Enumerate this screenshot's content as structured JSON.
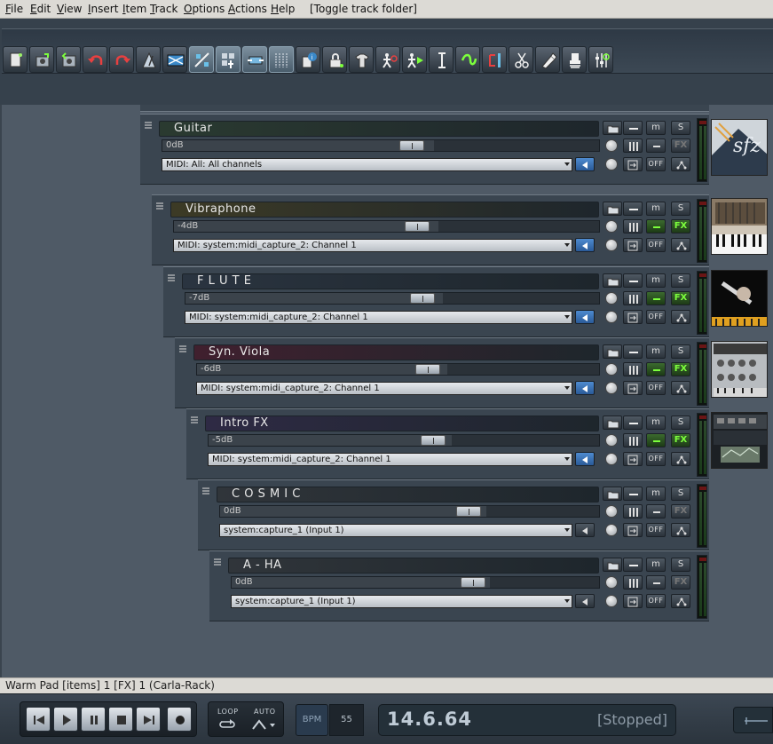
{
  "menu": [
    {
      "label": "File",
      "u": "F"
    },
    {
      "label": "Edit",
      "u": "E"
    },
    {
      "label": "View",
      "u": "V"
    },
    {
      "label": "Insert",
      "u": "I"
    },
    {
      "label": "Item",
      "u": "I"
    },
    {
      "label": "Track",
      "u": "T"
    },
    {
      "label": "Options",
      "u": "O"
    },
    {
      "label": "Actions",
      "u": "A"
    },
    {
      "label": "Help",
      "u": "H"
    },
    {
      "label": "[Toggle track folder]",
      "u": ""
    }
  ],
  "toolbar": {
    "buttons": [
      "new-project",
      "open-project",
      "save-project",
      "undo",
      "redo",
      "metronome",
      "auto-crossfade",
      "snap",
      "grid-select",
      "ripple-edit",
      "grid-lines",
      "item-properties",
      "lock",
      "trim",
      "render",
      "run-script",
      "text-tool",
      "glue",
      "split-tool",
      "draw-tool",
      "stamp-tool",
      "mixer"
    ],
    "active": [
      "snap",
      "grid-select",
      "ripple-edit",
      "grid-lines"
    ]
  },
  "tracks": [
    {
      "name": "Guitar",
      "volume_label": "0dB",
      "volume_level": 0.62,
      "input": "MIDI: All: All channels",
      "color": "#56a865",
      "namebar_color": "#2a3a30",
      "fx_state": "dim",
      "mute_state": "off",
      "monitor_on": true,
      "thumb": "sfz"
    },
    {
      "name": "Vibraphone",
      "volume_label": "-4dB",
      "volume_level": 0.62,
      "input": "MIDI: system:midi_capture_2: Channel 1",
      "color": "#b0a870",
      "namebar_color": "#3c3a25",
      "fx_state": "lit",
      "mute_state": "green",
      "monitor_on": true,
      "thumb": "keys"
    },
    {
      "name": "F L U T E",
      "volume_label": "-7dB",
      "volume_level": 0.62,
      "input": "MIDI: system:midi_capture_2: Channel 1",
      "color": "#7890a8",
      "namebar_color": "#2a3440",
      "fx_state": "lit",
      "mute_state": "green",
      "monitor_on": true,
      "thumb": "orchestra"
    },
    {
      "name": "Syn. Viola",
      "volume_label": "-6dB",
      "volume_level": 0.62,
      "input": "MIDI: system:midi_capture_2: Channel 1",
      "color": "#b06080",
      "namebar_color": "#40202e",
      "fx_state": "lit",
      "mute_state": "green",
      "monitor_on": true,
      "thumb": "synth"
    },
    {
      "name": "Intro FX",
      "volume_label": "-5dB",
      "volume_level": 0.62,
      "input": "MIDI: system:midi_capture_2: Channel 1",
      "color": "#8a80b8",
      "namebar_color": "#2e2a44",
      "fx_state": "lit",
      "mute_state": "green",
      "monitor_on": true,
      "thumb": "rack"
    },
    {
      "name": "C O S M I C",
      "volume_label": "0dB",
      "volume_level": 0.7,
      "input": "system:capture_1 (Input 1)",
      "color": "#8a8a8a",
      "namebar_color": "#30353a",
      "fx_state": "dim",
      "mute_state": "off",
      "monitor_on": false,
      "thumb": ""
    },
    {
      "name": "A  -  HA",
      "volume_label": "0dB",
      "volume_level": 0.7,
      "input": "system:capture_1 (Input 1)",
      "color": "#8a8a8a",
      "namebar_color": "#30353a",
      "fx_state": "dim",
      "mute_state": "off",
      "monitor_on": false,
      "thumb": ""
    }
  ],
  "track_buttons": {
    "mute": "m",
    "solo": "S",
    "fx": "FX",
    "off": "OFF"
  },
  "status": "Warm Pad [items] 1 [FX] 1 (Carla-Rack)",
  "transport": {
    "loop_label": "LOOP",
    "auto_label": "AUTO",
    "bpm_label": "BPM",
    "bpm_value": "55",
    "time": "14.6.64",
    "state": "[Stopped]"
  },
  "colors": {
    "accent_green": "#7cff3c",
    "accent_blue": "#3a78c8",
    "background": "#4a5561"
  }
}
